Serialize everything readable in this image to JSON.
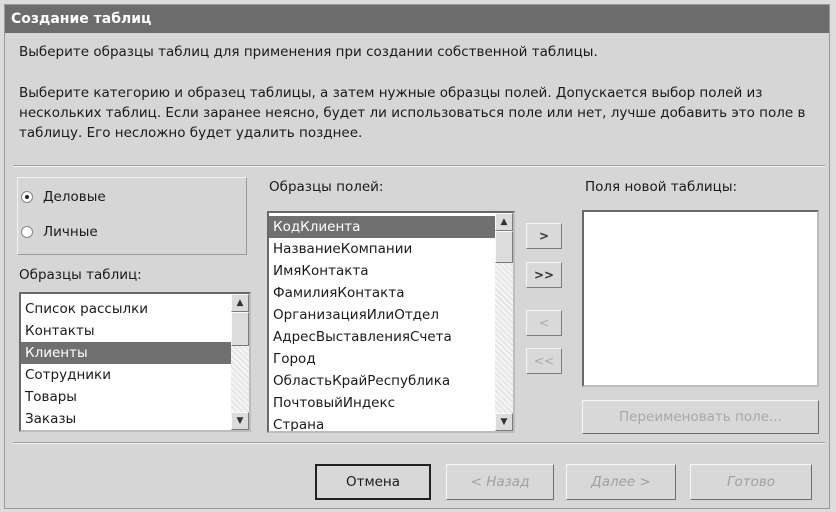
{
  "window": {
    "title": "Создание таблиц"
  },
  "intro": {
    "line1": "Выберите образцы таблиц для применения при создании собственной таблицы.",
    "line2": "Выберите категорию и образец таблицы, а затем нужные образцы полей. Допускается выбор полей из нескольких таблиц. Если заранее неясно, будет ли использоваться поле или нет, лучше добавить это поле в таблицу. Его несложно будет удалить позднее."
  },
  "category": {
    "options": [
      {
        "label": "Деловые",
        "selected": true
      },
      {
        "label": "Личные",
        "selected": false
      }
    ]
  },
  "sample_tables": {
    "label": "Образцы таблиц:",
    "items": [
      "Список рассылки",
      "Контакты",
      "Клиенты",
      "Сотрудники",
      "Товары",
      "Заказы"
    ],
    "selected": "Клиенты"
  },
  "sample_fields": {
    "label": "Образцы полей:",
    "items": [
      "КодКлиента",
      "НазваниеКомпании",
      "ИмяКонтакта",
      "ФамилияКонтакта",
      "ОрганизацияИлиОтдел",
      "АдресВыставленияСчета",
      "Город",
      "ОбластьКрайРеспублика",
      "ПочтовыйИндекс",
      "Страна"
    ],
    "selected": "КодКлиента"
  },
  "new_fields": {
    "label": "Поля новой таблицы:",
    "items": []
  },
  "move_buttons": {
    "add_one": ">",
    "add_all": ">>",
    "remove_one": "<",
    "remove_all": "<<"
  },
  "rename_button": "Переименовать поле...",
  "footer": {
    "cancel": "Отмена",
    "back": "< Назад",
    "next": "Далее >",
    "finish": "Готово"
  }
}
